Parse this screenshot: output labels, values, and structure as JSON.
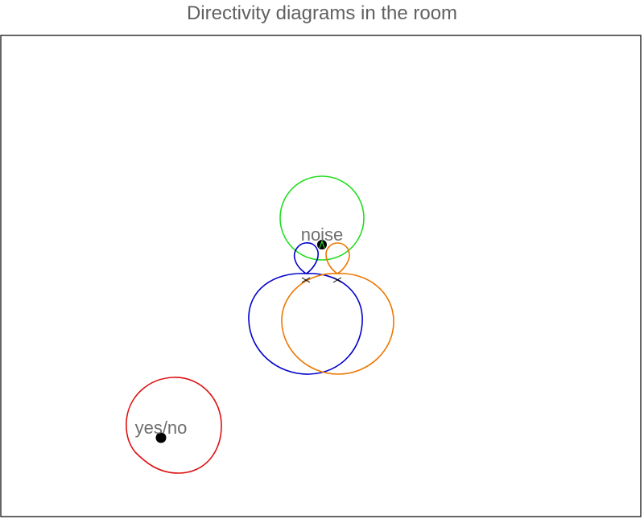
{
  "title": "Directivity diagrams in the room",
  "colors": {
    "noise_pattern": "#22dd22",
    "yesno_pattern": "#dd1111",
    "mic_left": "#0000cc",
    "mic_right": "#ee7700",
    "source_marker": "#000000",
    "mic_marker": "#000000",
    "room_border": "#000000",
    "label": "#6e6e6e"
  },
  "sources": [
    {
      "label": "noise",
      "pattern": "omnidirectional",
      "color_key": "noise_pattern"
    },
    {
      "label": "yes/no",
      "pattern": "omnidirectional",
      "color_key": "yesno_pattern"
    }
  ],
  "microphones": [
    {
      "pattern": "cardioid-with-rear-lobe",
      "color_key": "mic_left",
      "marker": "x"
    },
    {
      "pattern": "cardioid-with-rear-lobe",
      "color_key": "mic_right",
      "marker": "x"
    }
  ]
}
